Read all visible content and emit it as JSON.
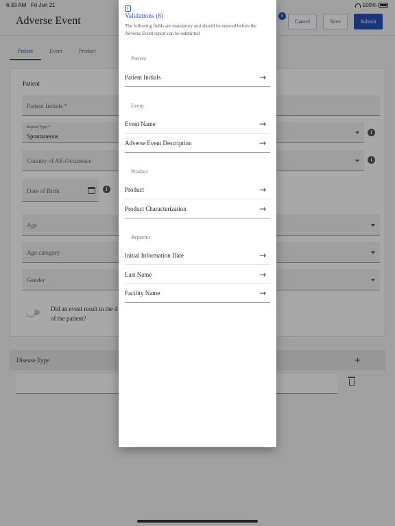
{
  "status_bar": {
    "time": "6:33 AM",
    "date": "Fri Jun 21",
    "battery": "100%"
  },
  "header": {
    "title": "Adverse Event",
    "notification_count": "6",
    "cancel_label": "Cancel",
    "save_label": "Save",
    "submit_label": "Submit"
  },
  "tabs": [
    {
      "label": "Patient",
      "active": true
    },
    {
      "label": "Event",
      "active": false
    },
    {
      "label": "Product",
      "active": false
    }
  ],
  "form": {
    "section_title": "Patient",
    "patient_initials_label": "Patient Initials *",
    "report_type_label": "Report Type *",
    "report_type_value": "Spontaneous",
    "country_label": "Country of AE-Occurence",
    "dob_label": "Date of Birth",
    "age_label": "Age",
    "age_category_label": "Age category",
    "gender_label": "Gender",
    "question_line1": "Did an event result in the d",
    "question_line2": "of the patient?"
  },
  "disease": {
    "label": "Disease Type"
  },
  "modal": {
    "title": "Validations (8)",
    "description": "The following fields are mandatory and should be entered before the Adverse Event report can be submitted",
    "groups": [
      {
        "name": "Patient",
        "items": [
          "Patient Initials"
        ]
      },
      {
        "name": "Event",
        "items": [
          "Event Name",
          "Adverse Event Description"
        ]
      },
      {
        "name": "Product",
        "items": [
          "Product",
          "Product Characterization"
        ]
      },
      {
        "name": "Reporter",
        "items": [
          "Initial Information Date",
          "Last Name",
          "Facility Name"
        ]
      }
    ]
  },
  "colors": {
    "accent": "#2851b7",
    "scrim": "rgba(0,0,0,0.34)"
  }
}
